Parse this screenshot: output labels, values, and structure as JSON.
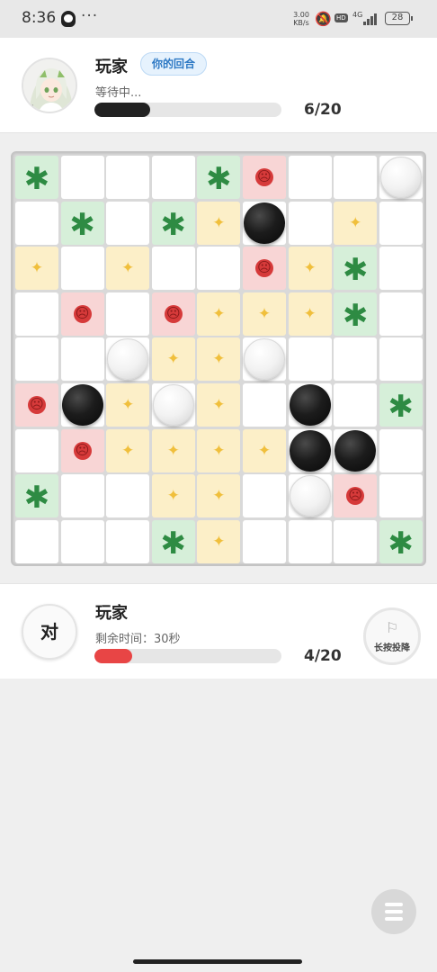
{
  "status_bar": {
    "time": "8:36",
    "more": "···",
    "net_speed_value": "3.00",
    "net_speed_unit": "KB/s",
    "hd": "HD",
    "network": "4G",
    "battery": "28"
  },
  "opponent": {
    "name": "玩家",
    "turn_badge": "你的回合",
    "status": "等待中...",
    "count": "6/20",
    "progress": 0.3,
    "progress_color": "#222222"
  },
  "player": {
    "char": "对",
    "name": "玩家",
    "time_left": "剩余时间：30秒",
    "count": "4/20",
    "progress": 0.2,
    "progress_color": "#e84545",
    "surrender": "长按投降"
  },
  "board": {
    "cols": 9,
    "rows": 9,
    "legend": {
      "S": "star",
      "Y": "spark",
      "R": "sad",
      ".": "empty"
    },
    "layout": [
      "S...SR...",
      ".S.SY..Y.",
      "Y.Y..RYS.",
      ".R.RYYYS.",
      "...YY....",
      "R.Y.Y...S",
      ".RYYYY...",
      "S..YY..R.",
      "...SY...S"
    ],
    "stones": [
      {
        "row": 0,
        "col": 8,
        "color": "white"
      },
      {
        "row": 1,
        "col": 5,
        "color": "black"
      },
      {
        "row": 4,
        "col": 2,
        "color": "white"
      },
      {
        "row": 4,
        "col": 5,
        "color": "white"
      },
      {
        "row": 5,
        "col": 1,
        "color": "black"
      },
      {
        "row": 5,
        "col": 3,
        "color": "white"
      },
      {
        "row": 5,
        "col": 6,
        "color": "black"
      },
      {
        "row": 6,
        "col": 6,
        "color": "black"
      },
      {
        "row": 6,
        "col": 7,
        "color": "black"
      },
      {
        "row": 7,
        "col": 6,
        "color": "white"
      }
    ],
    "colors": {
      "star_bg": "#d6efd9",
      "star_icon": "#2e8b43",
      "spark_bg": "#fcefc8",
      "spark_icon": "#f0bf3c",
      "sad_bg": "#f8d5d5",
      "sad_icon": "#d63a3a"
    },
    "icons": {
      "star": "asterisk-icon",
      "spark": "sparkle-icon",
      "sad": "sad-face-icon"
    }
  },
  "menu_icon": "hamburger-menu-icon"
}
